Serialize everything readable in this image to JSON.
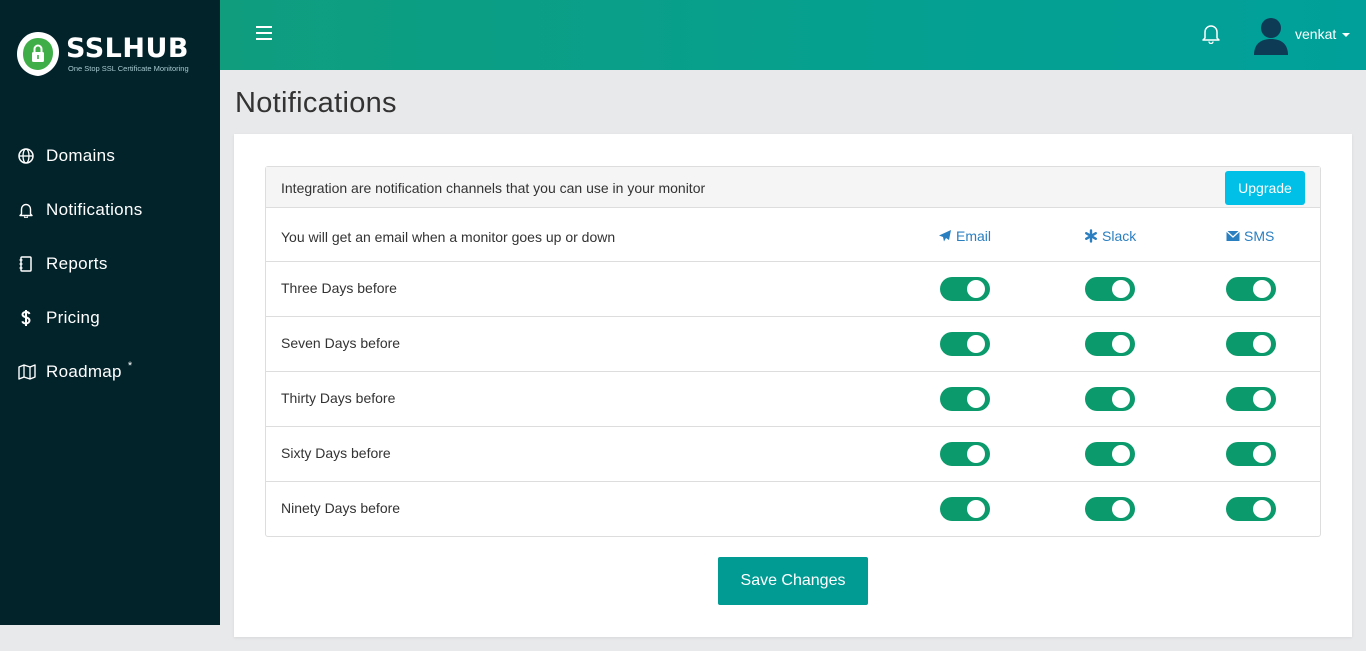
{
  "brand": {
    "name": "SSLHUB",
    "tagline": "One Stop SSL Certificate Monitoring"
  },
  "sidebar": {
    "items": [
      {
        "label": "Domains",
        "icon": "globe-icon"
      },
      {
        "label": "Notifications",
        "icon": "bell-icon"
      },
      {
        "label": "Reports",
        "icon": "notebook-icon"
      },
      {
        "label": "Pricing",
        "icon": "dollar-icon"
      },
      {
        "label": "Roadmap",
        "icon": "map-icon",
        "sup": "*"
      }
    ]
  },
  "topbar": {
    "menu_icon": "hamburger-icon",
    "notification_icon": "bell-icon",
    "user_name": "venkat"
  },
  "page": {
    "title": "Notifications"
  },
  "integration": {
    "header_text": "Integration are notification channels that you can use in your monitor",
    "upgrade_label": "Upgrade",
    "description": "You will get an email when a monitor goes up or down",
    "channels": [
      {
        "label": "Email",
        "icon": "paper-plane-icon"
      },
      {
        "label": "Slack",
        "icon": "asterisk-icon"
      },
      {
        "label": "SMS",
        "icon": "envelope-icon"
      }
    ],
    "rows": [
      {
        "label": "Three Days before",
        "email": true,
        "slack": true,
        "sms": true
      },
      {
        "label": "Seven Days before",
        "email": true,
        "slack": true,
        "sms": true
      },
      {
        "label": "Thirty Days before",
        "email": true,
        "slack": true,
        "sms": true
      },
      {
        "label": "Sixty Days before",
        "email": true,
        "slack": true,
        "sms": true
      },
      {
        "label": "Ninety Days before",
        "email": true,
        "slack": true,
        "sms": true
      }
    ],
    "save_label": "Save Changes"
  },
  "colors": {
    "sidebar_bg": "#03232b",
    "topbar_start": "#0f9d7e",
    "topbar_end": "#00a09a",
    "toggle_on": "#0b9a6b",
    "link": "#2a7fc0",
    "upgrade_button": "#00c0e8",
    "save_button": "#019b93"
  }
}
